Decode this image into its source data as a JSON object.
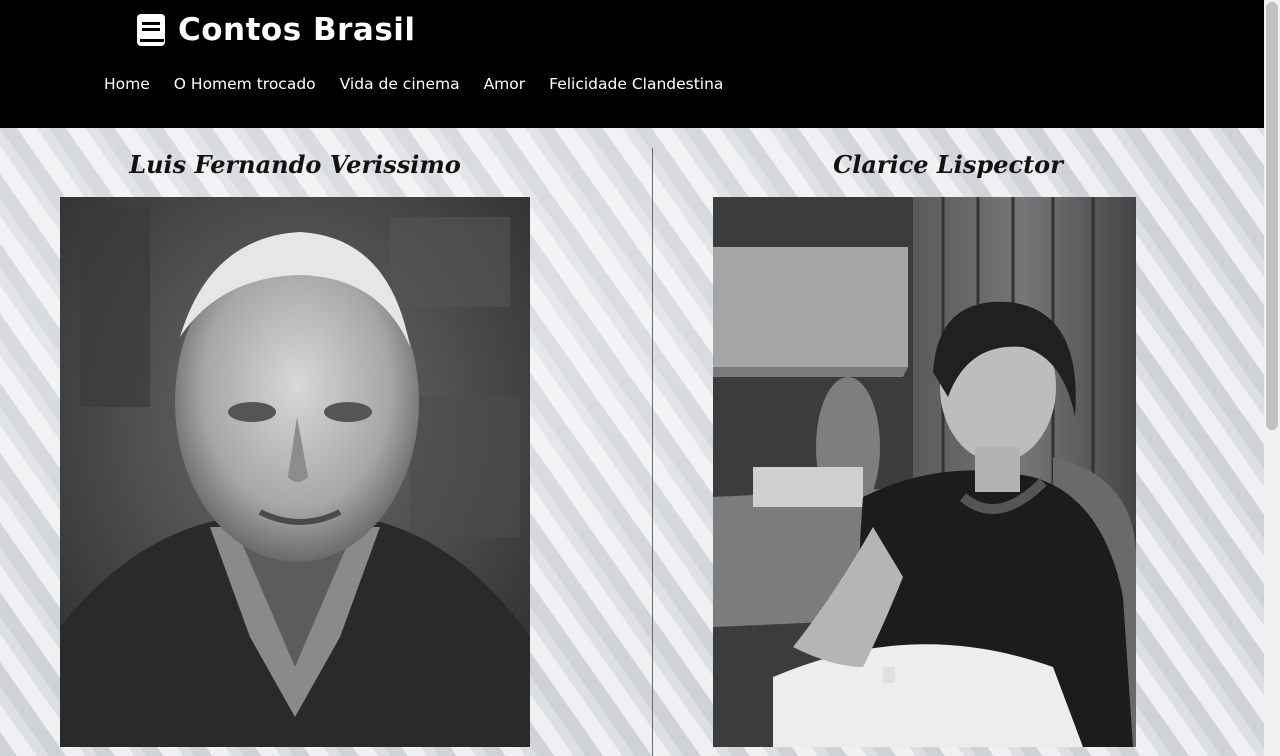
{
  "header": {
    "brand_icon": "book-icon",
    "brand_title": "Contos Brasil"
  },
  "nav": {
    "items": [
      {
        "label": "Home"
      },
      {
        "label": "O Homem trocado"
      },
      {
        "label": "Vida de cinema"
      },
      {
        "label": "Amor"
      },
      {
        "label": "Felicidade Clandestina"
      }
    ]
  },
  "authors": {
    "left": {
      "name": "Luis Fernando Verissimo"
    },
    "right": {
      "name": "Clarice Lispector"
    }
  },
  "colors": {
    "header_bg": "#000000",
    "header_text": "#ffffff",
    "title_text": "#111111"
  },
  "scrollbar": {
    "position_fraction": 0.0
  }
}
